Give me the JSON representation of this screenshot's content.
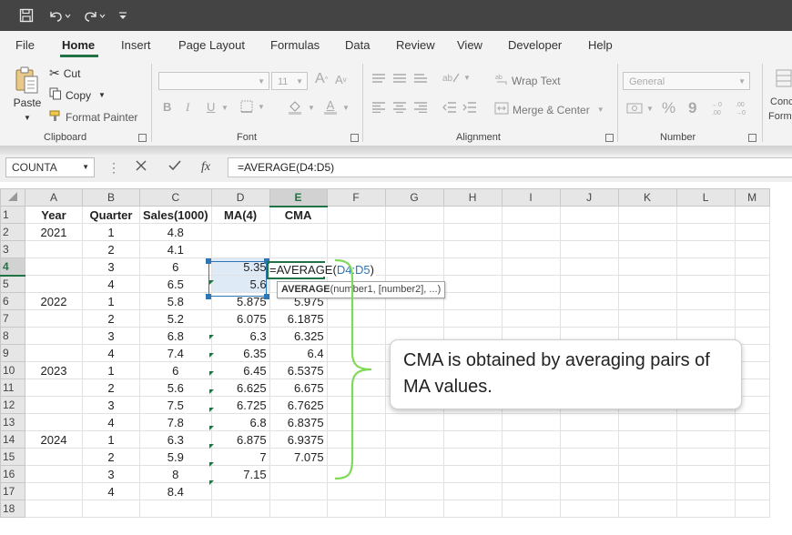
{
  "title_bar": {
    "icons": [
      "save-icon",
      "undo-icon",
      "redo-icon",
      "customize-qat-icon"
    ]
  },
  "menu": {
    "items": [
      "File",
      "Home",
      "Insert",
      "Page Layout",
      "Formulas",
      "Data",
      "Review",
      "View",
      "Developer",
      "Help"
    ],
    "active": "Home"
  },
  "ribbon": {
    "clipboard": {
      "group_label": "Clipboard",
      "paste": "Paste",
      "cut": "Cut",
      "copy": "Copy",
      "format_painter": "Format Painter"
    },
    "font": {
      "group_label": "Font",
      "font_size": "11",
      "bold": "B",
      "italic": "I",
      "underline": "U",
      "grow": "A",
      "shrink": "A",
      "font_color": "A"
    },
    "alignment": {
      "group_label": "Alignment",
      "wrap_text": "Wrap Text",
      "merge_center": "Merge & Center"
    },
    "number": {
      "group_label": "Number",
      "format": "General",
      "percent": "%",
      "comma": "9"
    },
    "styles": {
      "label_line1": "Conc",
      "label_line2": "Form"
    }
  },
  "formula_bar": {
    "name_box": "COUNTA",
    "fx": "fx",
    "formula": "=AVERAGE(D4:D5)"
  },
  "columns": [
    "A",
    "B",
    "C",
    "D",
    "E",
    "F",
    "G",
    "H",
    "I",
    "J",
    "K",
    "L",
    "M"
  ],
  "rows": [
    {
      "n": "1",
      "a": "Year",
      "b": "Quarter",
      "c": "Sales(1000)",
      "d": "MA(4)",
      "e": "CMA"
    },
    {
      "n": "2",
      "a": "2021",
      "b": "1",
      "c": "4.8",
      "d": "",
      "e": ""
    },
    {
      "n": "3",
      "a": "",
      "b": "2",
      "c": "4.1",
      "d": "",
      "e": ""
    },
    {
      "n": "4",
      "a": "",
      "b": "3",
      "c": "6",
      "d": "5.35",
      "e": ""
    },
    {
      "n": "5",
      "a": "",
      "b": "4",
      "c": "6.5",
      "d": "5.6",
      "e": ""
    },
    {
      "n": "6",
      "a": "2022",
      "b": "1",
      "c": "5.8",
      "d": "5.875",
      "e": "5.975"
    },
    {
      "n": "7",
      "a": "",
      "b": "2",
      "c": "5.2",
      "d": "6.075",
      "e": "6.1875"
    },
    {
      "n": "8",
      "a": "",
      "b": "3",
      "c": "6.8",
      "d": "6.3",
      "e": "6.325"
    },
    {
      "n": "9",
      "a": "",
      "b": "4",
      "c": "7.4",
      "d": "6.35",
      "e": "6.4"
    },
    {
      "n": "10",
      "a": "2023",
      "b": "1",
      "c": "6",
      "d": "6.45",
      "e": "6.5375"
    },
    {
      "n": "11",
      "a": "",
      "b": "2",
      "c": "5.6",
      "d": "6.625",
      "e": "6.675"
    },
    {
      "n": "12",
      "a": "",
      "b": "3",
      "c": "7.5",
      "d": "6.725",
      "e": "6.7625"
    },
    {
      "n": "13",
      "a": "",
      "b": "4",
      "c": "7.8",
      "d": "6.8",
      "e": "6.8375"
    },
    {
      "n": "14",
      "a": "2024",
      "b": "1",
      "c": "6.3",
      "d": "6.875",
      "e": "6.9375"
    },
    {
      "n": "15",
      "a": "",
      "b": "2",
      "c": "5.9",
      "d": "7",
      "e": "7.075"
    },
    {
      "n": "16",
      "a": "",
      "b": "3",
      "c": "8",
      "d": "7.15",
      "e": ""
    },
    {
      "n": "17",
      "a": "",
      "b": "4",
      "c": "8.4",
      "d": "",
      "e": ""
    },
    {
      "n": "18",
      "a": "",
      "b": "",
      "c": "",
      "d": "",
      "e": ""
    }
  ],
  "edit_cell": {
    "prefix": "=AVERAGE(",
    "ref": "D4:D5",
    "suffix": ")"
  },
  "tooltip": {
    "func": "AVERAGE",
    "args": "(number1, [number2], ...)"
  },
  "callout": {
    "text": "CMA is obtained by averaging pairs of MA values."
  },
  "colors": {
    "accent": "#217346",
    "title_bar": "#444444",
    "ref_blue": "#2e75b6",
    "brace": "#7ed957"
  }
}
